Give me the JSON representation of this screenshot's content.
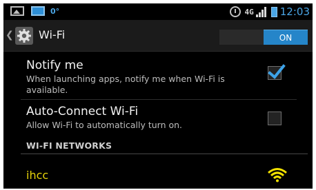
{
  "status_bar": {
    "temperature": "0°",
    "network_type": "4G",
    "time": "12:03",
    "icons": [
      "gallery-icon",
      "notification-icon",
      "alarm-icon",
      "signal-icon",
      "battery-icon"
    ]
  },
  "action_bar": {
    "title": "Wi-Fi",
    "toggle_label": "ON",
    "icons": [
      "back-chevron-icon",
      "settings-gear-icon"
    ]
  },
  "settings": [
    {
      "title": "Notify me",
      "summary": "When launching apps, notify me when Wi-Fi is available.",
      "checked": true
    },
    {
      "title": "Auto-Connect Wi-Fi",
      "summary": "Allow Wi-Fi to automatically turn on.",
      "checked": false
    }
  ],
  "networks_section": {
    "header": "WI-FI NETWORKS",
    "networks": [
      {
        "name": "ihcc",
        "signal_icon": "wifi-signal-icon"
      }
    ]
  },
  "colors": {
    "accent": "#2585c9",
    "network_highlight": "#e6d30a",
    "background": "#000000"
  }
}
